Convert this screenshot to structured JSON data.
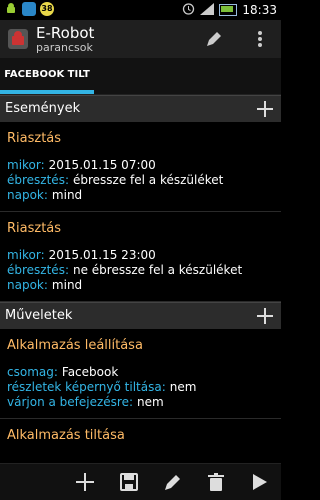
{
  "statusbar": {
    "time": "18:33",
    "badge": "38"
  },
  "app": {
    "title": "E-Robot",
    "subtitle": "parancsok"
  },
  "tabs": [
    {
      "label": "FACEBOOK TILT"
    }
  ],
  "events_section": {
    "title": "Események",
    "items": [
      {
        "title": "Riasztás",
        "rows": [
          {
            "key": "mikor:",
            "value": "2015.01.15 07:00"
          },
          {
            "key": "ébresztés:",
            "value": "ébressze fel a készüléket"
          },
          {
            "key": "napok:",
            "value": "mind"
          }
        ]
      },
      {
        "title": "Riasztás",
        "rows": [
          {
            "key": "mikor:",
            "value": "2015.01.15 23:00"
          },
          {
            "key": "ébresztés:",
            "value": "ne ébressze fel a készüléket"
          },
          {
            "key": "napok:",
            "value": "mind"
          }
        ]
      }
    ]
  },
  "actions_section": {
    "title": "Műveletek",
    "items": [
      {
        "title": "Alkalmazás leállítása",
        "rows": [
          {
            "key": "csomag:",
            "value": "Facebook"
          },
          {
            "key": "részletek képernyő tiltása:",
            "value": "nem"
          },
          {
            "key": "várjon a befejezésre:",
            "value": "nem"
          }
        ]
      },
      {
        "title": "Alkalmazás tiltása"
      }
    ]
  }
}
